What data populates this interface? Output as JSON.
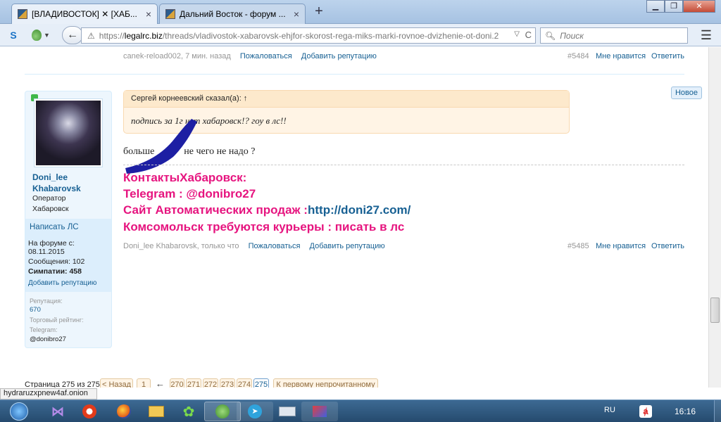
{
  "browser": {
    "tabs": [
      {
        "label": "[ВЛАДИВОСТОК] ✕ [ХАБ...",
        "active": true
      },
      {
        "label": "Дальний Восток - форум ...",
        "active": false
      }
    ],
    "url_proto": "https://",
    "url_host": "legalrc.biz",
    "url_path": "/threads/vladivostok-xabarovsk-ehjfor-skorost-rega-miks-marki-rovnoe-dvizhenie-ot-doni.2",
    "search_placeholder": "Поиск"
  },
  "prev_post": {
    "author": "canek-reload002",
    "time": "7 мин. назад",
    "report": "Пожаловаться",
    "add_rep": "Добавить репутацию",
    "number": "#5484",
    "dislike": "Мне нравится",
    "reply": "Ответить"
  },
  "new_badge": "Новое",
  "post": {
    "user": {
      "name": "Doni_lee Khabarovsk",
      "role": "Оператор",
      "city": "Хабаровск",
      "write_pm": "Написать ЛС",
      "since_label": "На форуме с:",
      "since_value": "08.11.2015",
      "messages_label": "Сообщения:",
      "messages_value": "102",
      "sympathy_label": "Симпатии:",
      "sympathy_value": "458",
      "add_rep": "Добавить репутацию",
      "rep_label": "Репутация:",
      "rep_value": "670",
      "trade_label": "Торговый рейтинг:",
      "telegram_label": "Telegram:",
      "telegram_value": "@donibro27"
    },
    "quote_head": "Сергей корнеевский сказал(а): ↑",
    "quote_body": "подпись за 1г нэт хабаровск!? гоу в лс!!",
    "text": "больше            не чего не надо ?",
    "sig_line1": "КонтактыХабаровск:",
    "sig_line2": "Telegram : @donibro27",
    "sig_line3_prefix": "Сайт Автоматических продаж :",
    "sig_line3_link": "http://doni27.com/",
    "sig_line4": "Комсомольск требуются курьеры : писать в лс",
    "footer_author": "Doni_lee Khabarovsk",
    "footer_time": "только что",
    "report": "Пожаловаться",
    "add_rep": "Добавить репутацию",
    "number": "#5485",
    "like": "Мне нравится",
    "reply": "Ответить"
  },
  "pagination": {
    "label": "Страница 275 из 275",
    "prev": "< Назад",
    "first": "1",
    "ellipsis": "←",
    "pages": [
      "270",
      "271",
      "272",
      "273",
      "274",
      "275"
    ],
    "unread": "К первому непрочитанному"
  },
  "status_url": "hydraruzxpnew4af.onion",
  "taskbar": {
    "lang": "RU",
    "time": "16:16"
  }
}
